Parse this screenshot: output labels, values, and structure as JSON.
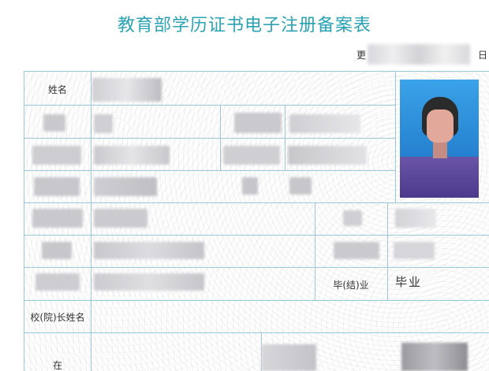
{
  "document": {
    "title": "教育部学历证书电子注册备案表",
    "update_prefix": "更",
    "update_suffix": "日"
  },
  "fields": {
    "name_label": "姓名",
    "status_label": "毕(结)业",
    "status_value": "毕业",
    "president_label": "校(院)长姓名",
    "bottom_label": "在"
  },
  "photo": {
    "icon": "student-photo"
  }
}
